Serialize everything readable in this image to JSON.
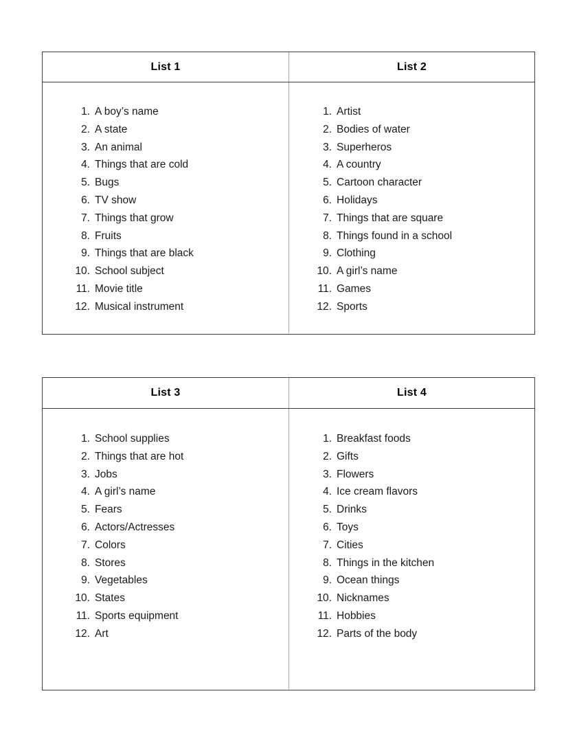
{
  "document": {
    "title": "List 1",
    "tables": [
      {
        "name": "tables-1-2",
        "columns": [
          {
            "header": "List 1",
            "items": [
              "A boy’s name",
              "A state",
              "An animal",
              "Things that are cold",
              "Bugs",
              "TV show",
              "Things that grow",
              "Fruits",
              "Things that are black",
              "School subject",
              "Movie title",
              "Musical instrument"
            ]
          },
          {
            "header": "List 2",
            "items": [
              "Artist",
              "Bodies of water",
              "Superheros",
              "A country",
              "Cartoon character",
              "Holidays",
              "Things that are square",
              "Things found in a school",
              "Clothing",
              "A girl’s name",
              "Games",
              "Sports"
            ]
          }
        ]
      },
      {
        "name": "tables-3-4",
        "columns": [
          {
            "header": "List 3",
            "items": [
              "School supplies",
              "Things that are hot",
              "Jobs",
              "A girl’s name",
              "Fears",
              "Actors/Actresses",
              "Colors",
              "Stores",
              "Vegetables",
              "States",
              "Sports equipment",
              "Art"
            ]
          },
          {
            "header": "List 4",
            "items": [
              "Breakfast foods",
              "Gifts",
              "Flowers",
              "Ice cream flavors",
              "Drinks",
              "Toys",
              "Cities",
              "Things in the kitchen",
              "Ocean things",
              "Nicknames",
              "Hobbies",
              "Parts of the body"
            ]
          }
        ]
      }
    ],
    "numbering": {
      "suffix": ".",
      "values": [
        1,
        2,
        3,
        4,
        5,
        6,
        7,
        8,
        9,
        10,
        11,
        12
      ]
    },
    "colors": {
      "page_background": "#ffffff",
      "outer_border": "#404040",
      "inner_divider": "#a6a6a6",
      "header_text": "#000000",
      "body_text": "#1a1a1a"
    }
  }
}
